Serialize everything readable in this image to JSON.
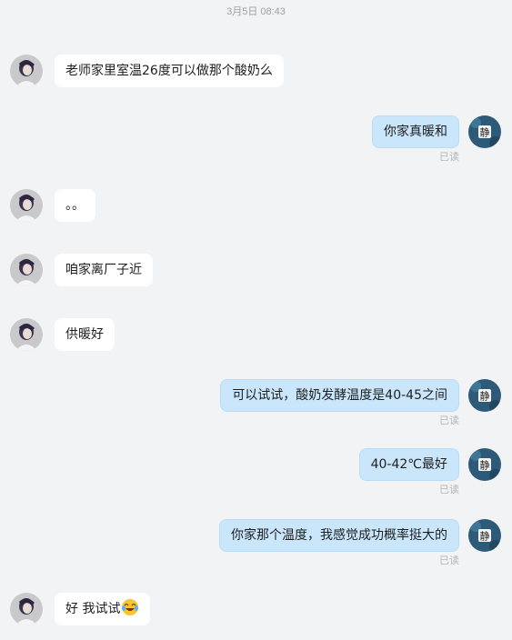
{
  "timestamp": "3月5日  08:43",
  "read_label": "已读",
  "colors": {
    "background": "#f2f3f5",
    "incoming_bubble": "#ffffff",
    "outgoing_bubble": "#c9e6fb",
    "read_text": "#b5b5b5"
  },
  "messages": [
    {
      "side": "left",
      "text": "老师家里室温26度可以做那个酸奶么",
      "avatar": "contact-avatar"
    },
    {
      "side": "right",
      "text": "你家真暖和",
      "read": true,
      "avatar": "self-avatar"
    },
    {
      "side": "left",
      "text": "。。",
      "avatar": "contact-avatar"
    },
    {
      "side": "left",
      "text": "咱家离厂子近",
      "avatar": "contact-avatar"
    },
    {
      "side": "left",
      "text": "供暖好",
      "avatar": "contact-avatar"
    },
    {
      "side": "right",
      "text": "可以试试，酸奶发酵温度是40-45之间",
      "read": true,
      "avatar": "self-avatar"
    },
    {
      "side": "right",
      "text": "40-42℃最好",
      "read": true,
      "avatar": "self-avatar"
    },
    {
      "side": "right",
      "text": "你家那个温度，我感觉成功概率挺大的",
      "read": true,
      "avatar": "self-avatar"
    },
    {
      "side": "left",
      "text": "好 我试试",
      "emoji": "laughing-tears-emoji",
      "avatar": "contact-avatar"
    }
  ],
  "self_avatar_glyph": "静"
}
